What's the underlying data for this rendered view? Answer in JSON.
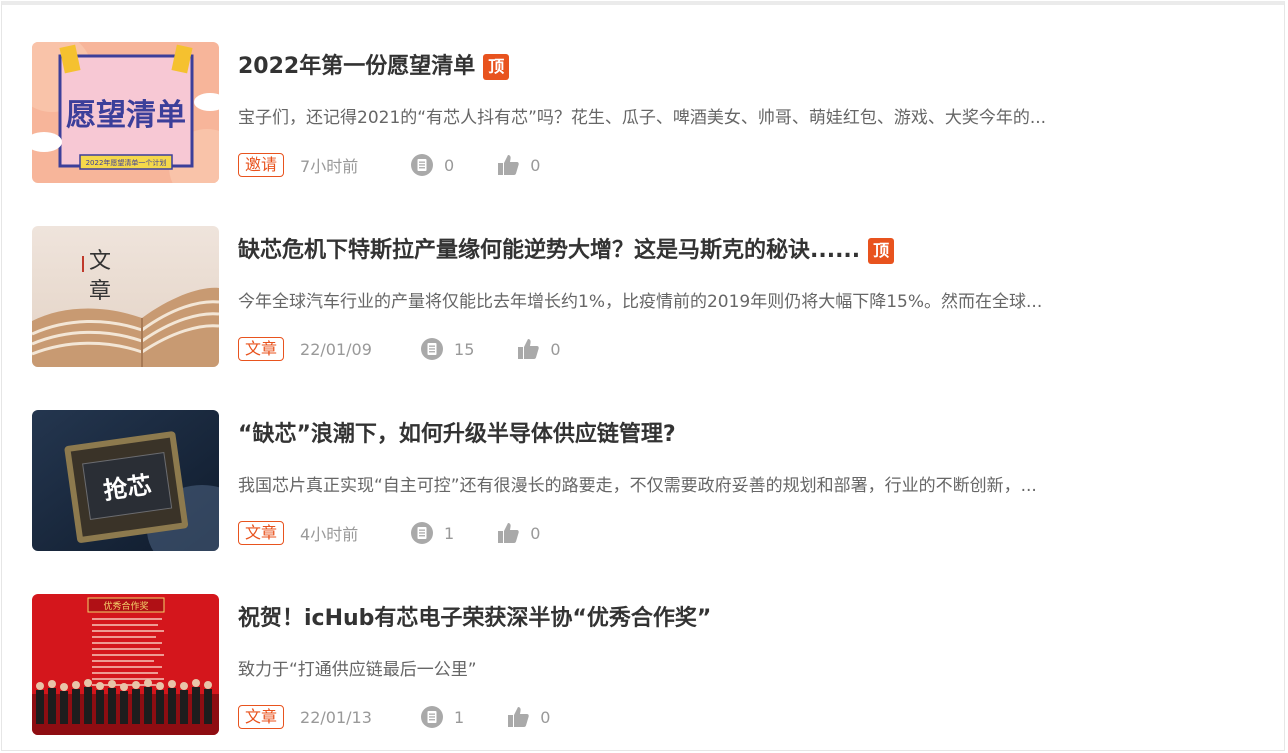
{
  "feed": {
    "items": [
      {
        "title": "2022年第一份愿望清单",
        "pinned": true,
        "pinned_label": "顶",
        "summary": "宝子们，还记得2021的“有芯人抖有芯”吗？花生、瓜子、啤酒美女、帅哥、萌娃红包、游戏、大奖今年的...",
        "tag": "邀请",
        "time": "7小时前",
        "comments": "0",
        "likes": "0",
        "thumb_text": "愿望清单",
        "thumb_subtext": "2022年愿望清单一个计划"
      },
      {
        "title": "缺芯危机下特斯拉产量缘何能逆势大增？这是马斯克的秘诀......",
        "pinned": true,
        "pinned_label": "顶",
        "summary": "今年全球汽车行业的产量将仅能比去年增长约1%，比疫情前的2019年则仍将大幅下降15%。然而在全球...",
        "tag": "文章",
        "time": "22/01/09",
        "comments": "15",
        "likes": "0",
        "thumb_text": "文章"
      },
      {
        "title": "“缺芯”浪潮下，如何升级半导体供应链管理?",
        "pinned": false,
        "summary": "我国芯片真正实现“自主可控”还有很漫长的路要走，不仅需要政府妥善的规划和部署，行业的不断创新，...",
        "tag": "文章",
        "time": "4小时前",
        "comments": "1",
        "likes": "0",
        "thumb_text": "抢芯"
      },
      {
        "title": "祝贺！icHub有芯电子荣获深半协“优秀合作奖”",
        "pinned": false,
        "summary": "致力于“打通供应链最后一公里”",
        "tag": "文章",
        "time": "22/01/13",
        "comments": "1",
        "likes": "0",
        "thumb_text": "优秀合作奖"
      }
    ]
  },
  "icons": {
    "comment": "comment-icon",
    "like": "thumbs-up-icon"
  },
  "colors": {
    "accent": "#e8531e",
    "title": "#333333",
    "summary": "#666666",
    "meta": "#999999"
  }
}
